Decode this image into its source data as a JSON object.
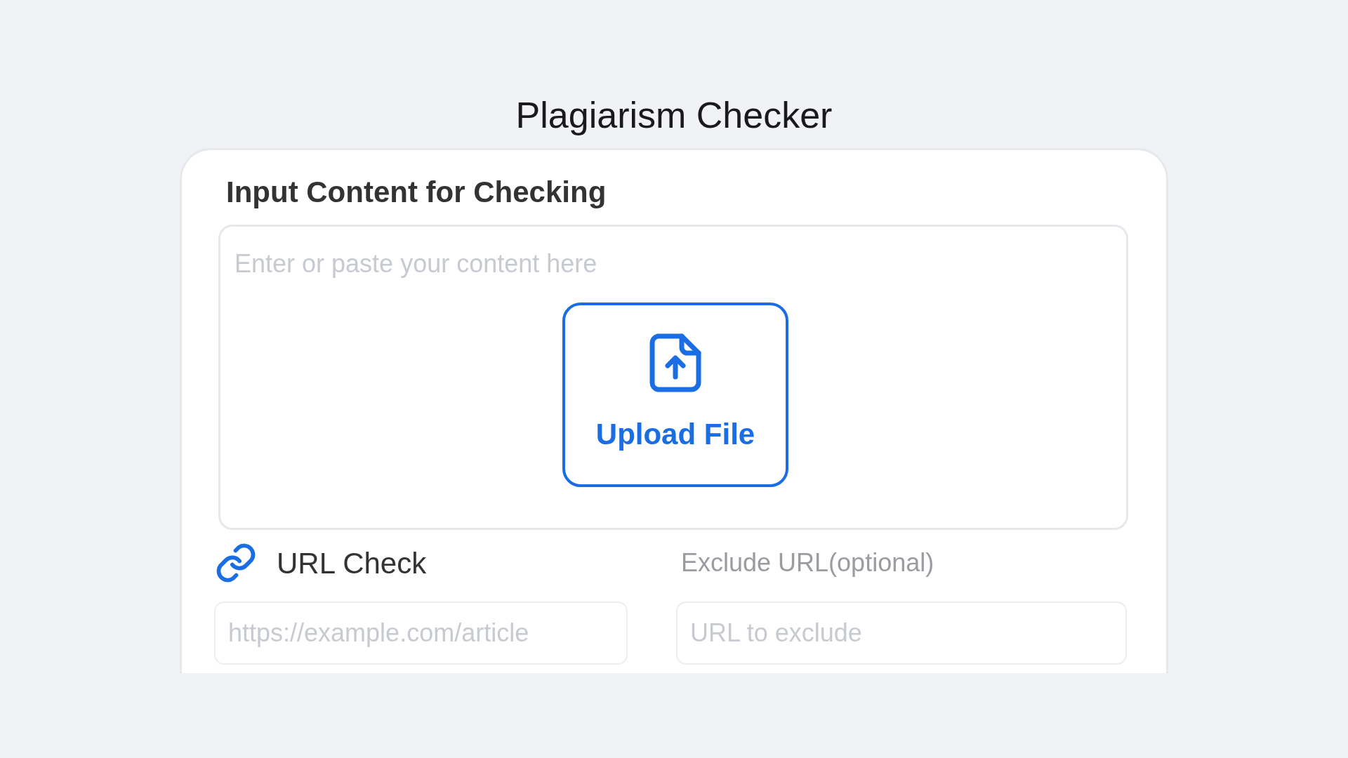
{
  "title": "Plagiarism Checker",
  "content_section": {
    "heading": "Input Content for Checking",
    "content_field": {
      "placeholder": "Enter or paste your content here"
    },
    "upload_button": {
      "label": "Upload File"
    }
  },
  "url_check": {
    "label": "URL Check",
    "url_field": {
      "placeholder": "https://example.com/article"
    }
  },
  "exclude": {
    "label": "Exclude URL(optional)",
    "exclude_field": {
      "placeholder": "URL to exclude"
    }
  }
}
